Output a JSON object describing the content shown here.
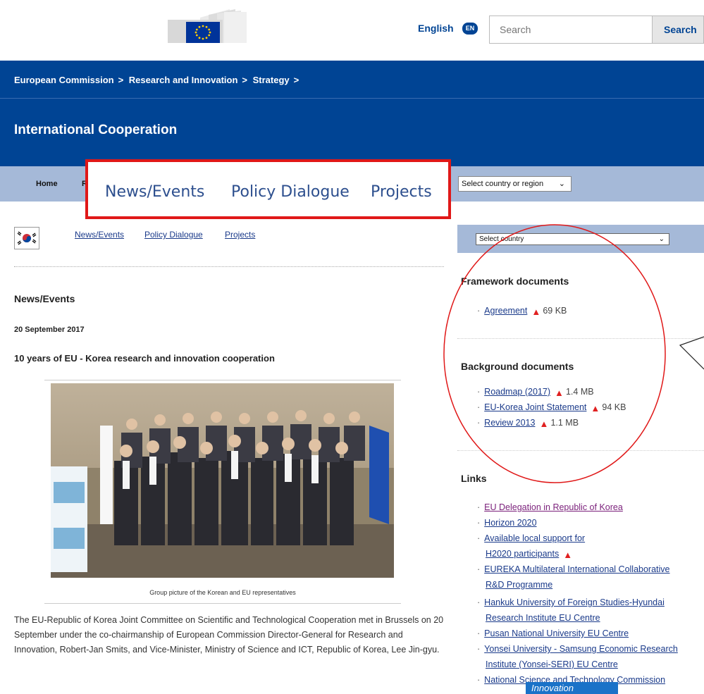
{
  "header": {
    "language_label": "English",
    "language_code": "EN",
    "search_placeholder": "Search",
    "search_button": "Search"
  },
  "breadcrumb": [
    "European Commission",
    "Research and Innovation",
    "Strategy"
  ],
  "breadcrumb_separator": ">",
  "site_title": "International Cooperation",
  "nav": {
    "home": "Home",
    "partial_item": "R",
    "country_region_select": "Select country or region"
  },
  "zoom_callout": {
    "items": [
      "News/Events",
      "Policy Dialogue",
      "Projects"
    ],
    "border_color": "#e01818"
  },
  "subnav": [
    "News/Events",
    "Policy Dialogue",
    "Projects"
  ],
  "news": {
    "section_heading": "News/Events",
    "date": "20 September 2017",
    "title": "10 years of EU - Korea research and innovation cooperation",
    "caption": "Group picture of the Korean and EU representatives",
    "body": "The EU-Republic of Korea Joint Committee on Scientific and Technological Cooperation met in Brussels on 20 September under the co-chairmanship of European Commission Director-General for Research and Innovation, Robert-Jan Smits, and Vice-Minister, Ministry of Science and ICT, Republic of Korea, Lee Jin-gyu."
  },
  "sidebar": {
    "select_country": "Select country",
    "framework": {
      "heading": "Framework documents",
      "items": [
        {
          "label": "Agreement",
          "size": "69 KB"
        }
      ]
    },
    "background": {
      "heading": "Background documents",
      "items": [
        {
          "label": "Roadmap (2017)",
          "size": "1.4 MB"
        },
        {
          "label": "EU-Korea Joint Statement",
          "size": "94 KB"
        },
        {
          "label": "Review 2013",
          "size": "1.1 MB"
        }
      ]
    },
    "links": {
      "heading": "Links",
      "items": [
        "EU Delegation in Republic of Korea",
        "Horizon 2020",
        "Available local support for",
        "H2020 participants",
        "EUREKA Multilateral International Collaborative",
        "R&D Programme",
        "Hankuk University of Foreign Studies-Hyundai",
        "Research Institute EU Centre",
        "Pusan National University EU Centre",
        "Yonsei University - Samsung Economic Research",
        "Institute (Yonsei-SERI) EU Centre",
        "National Science and Technology Commission"
      ]
    }
  },
  "tooltip_text": "Innovation",
  "colors": {
    "ec_blue": "#004494",
    "nav_band": "#a5b9d8",
    "link": "#1a3a8a",
    "annotation_red": "#e01818"
  }
}
